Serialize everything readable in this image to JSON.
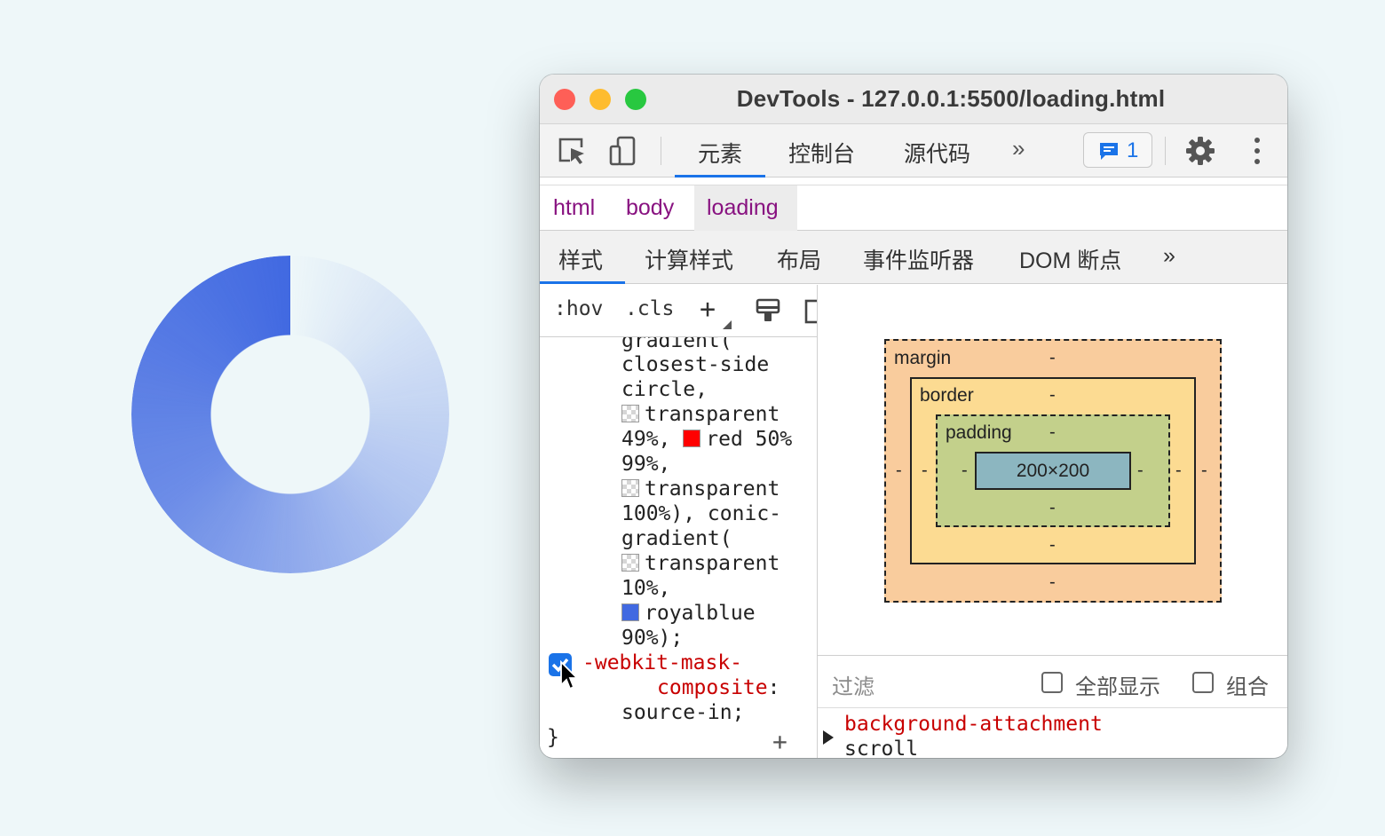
{
  "window": {
    "title": "DevTools - 127.0.0.1:5500/loading.html"
  },
  "toolbar": {
    "tabs": [
      "元素",
      "控制台",
      "源代码"
    ],
    "more": "»",
    "messages_count": "1",
    "inspect_icon": "inspect-icon",
    "device_icon": "device-icon",
    "settings_icon": "gear-icon",
    "menu_icon": "kebab-menu-icon"
  },
  "breadcrumbs": [
    "html",
    "body",
    "loading"
  ],
  "subtabs": [
    "样式",
    "计算样式",
    "布局",
    "事件监听器",
    "DOM 断点"
  ],
  "subtabs_more": "»",
  "stylebar": {
    "hov": ":hov",
    "cls": ".cls",
    "add": "+"
  },
  "styles_code": {
    "lines": [
      "gradient(",
      "closest-side",
      "circle,",
      "transparent",
      "49%,",
      "red 50%",
      "99%,",
      "transparent",
      "100%), conic-",
      "gradient(",
      "transparent",
      "10%,",
      "royalblue",
      "90%);"
    ],
    "mask_composite_prop_1": "-webkit-mask-",
    "mask_composite_prop_2": "composite",
    "colon": ":",
    "mask_composite_value": "source-in;",
    "close_brace": "}",
    "add": "+"
  },
  "box_model": {
    "margin_label": "margin",
    "border_label": "border",
    "padding_label": "padding",
    "content": "200×200",
    "dash": "-"
  },
  "filter": {
    "placeholder": "过滤",
    "show_all": "全部显示",
    "group": "组合"
  },
  "computed": {
    "property": "background-attachment",
    "value": "scroll"
  },
  "colors": {
    "accent": "#1a73e8",
    "margin": "#f9cc9d",
    "border": "#fcdb92",
    "padding": "#c3d08b",
    "content": "#8cb6c0",
    "spinner": "#4169e1"
  }
}
